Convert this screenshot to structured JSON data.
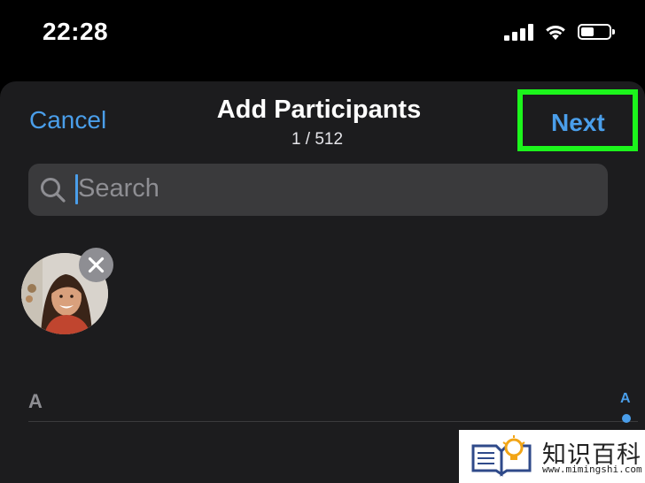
{
  "status_bar": {
    "time": "22:28",
    "battery_level": 0.45
  },
  "nav": {
    "cancel_label": "Cancel",
    "title": "Add Participants",
    "subtitle": "1 / 512",
    "next_label": "Next"
  },
  "search": {
    "placeholder": "Search"
  },
  "selected": [
    {
      "avatar_icon": "person-photo"
    }
  ],
  "list": {
    "section_header": "A",
    "index_letters": [
      "A"
    ]
  },
  "watermark": {
    "title": "知识百科",
    "url": "www.mimingshi.com"
  },
  "colors": {
    "accent": "#4a9eea",
    "highlight": "#1cf51c",
    "sheet": "#1c1c1e",
    "field": "#3a3a3c"
  }
}
